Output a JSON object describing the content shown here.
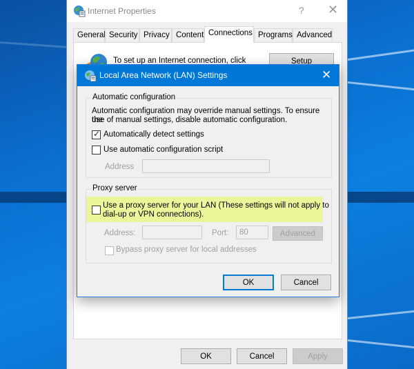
{
  "window": {
    "title": "Internet Properties",
    "help_label": "?",
    "close_label": "✕",
    "tabs": [
      {
        "label": "General",
        "active": false
      },
      {
        "label": "Security",
        "active": false
      },
      {
        "label": "Privacy",
        "active": false
      },
      {
        "label": "Content",
        "active": false
      },
      {
        "label": "Connections",
        "active": true
      },
      {
        "label": "Programs",
        "active": false
      },
      {
        "label": "Advanced",
        "active": false
      }
    ],
    "connections": {
      "setup_text": "To set up an Internet connection, click",
      "setup_button": "Setup"
    },
    "footer": {
      "ok": "OK",
      "cancel": "Cancel",
      "apply": "Apply"
    }
  },
  "dialog": {
    "title": "Local Area Network (LAN) Settings",
    "close_label": "✕",
    "auto_config": {
      "legend": "Automatic configuration",
      "description_line1": "Automatic configuration may override manual settings.  To ensure the",
      "description_line2": "use of manual settings, disable automatic configuration.",
      "auto_detect": {
        "label": "Automatically detect settings",
        "checked": true
      },
      "use_script": {
        "label": "Use automatic configuration script",
        "checked": false
      },
      "address_label": "Address",
      "address_value": ""
    },
    "proxy": {
      "legend": "Proxy server",
      "use_proxy": {
        "label_line1": "Use a proxy server for your LAN (These settings will not apply to",
        "label_line2": "dial-up or VPN connections).",
        "checked": false,
        "highlight_color": "#ecf59a"
      },
      "address_label": "Address:",
      "address_value": "",
      "port_label": "Port:",
      "port_value": "80",
      "advanced_button": "Advanced",
      "bypass": {
        "label": "Bypass proxy server for local addresses",
        "checked": false
      }
    },
    "ok": "OK",
    "cancel": "Cancel",
    "accent_color": "#0078d7"
  }
}
